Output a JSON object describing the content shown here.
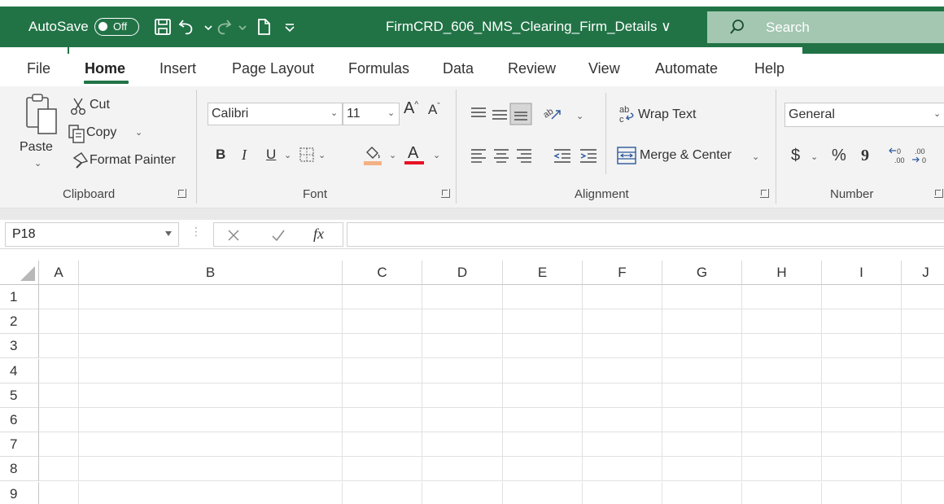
{
  "titlebar": {
    "autosave_label": "AutoSave",
    "autosave_state": "Off",
    "filename": "FirmCRD_606_NMS_Clearing_Firm_Details",
    "filename_chevron": "∨",
    "search_label": "Search",
    "icons": [
      "save-icon",
      "undo-icon",
      "redo-icon",
      "new-file-icon",
      "customize-qat-icon",
      "search-icon"
    ]
  },
  "tabs": [
    "File",
    "Home",
    "Insert",
    "Page Layout",
    "Formulas",
    "Data",
    "Review",
    "View",
    "Automate",
    "Help"
  ],
  "active_tab": "Home",
  "ribbon": {
    "clipboard": {
      "paste_label": "Paste",
      "cut_label": "Cut",
      "copy_label": "Copy",
      "format_painter_label": "Format Painter",
      "group_label": "Clipboard"
    },
    "font": {
      "font_name": "Calibri",
      "font_size": "11",
      "bold": "B",
      "italic": "I",
      "underline": "U",
      "group_label": "Font",
      "fill_color": "#f4b183",
      "font_color": "#e81123"
    },
    "alignment": {
      "wrap_text_label": "Wrap Text",
      "merge_center_label": "Merge & Center",
      "group_label": "Alignment"
    },
    "number": {
      "format": "General",
      "currency_symbol": "$",
      "percent_symbol": "%",
      "comma_symbol": "9",
      "group_label": "Number"
    }
  },
  "formula_bar": {
    "name_box": "P18",
    "fx_label": "fx",
    "formula": ""
  },
  "sheet": {
    "columns": [
      "A",
      "B",
      "C",
      "D",
      "E",
      "F",
      "G",
      "H",
      "I",
      "J"
    ],
    "rows": [
      "1",
      "2",
      "3",
      "4",
      "5",
      "6",
      "7",
      "8",
      "9"
    ]
  },
  "colors": {
    "accent": "#217346",
    "search_box": "#a3c7b1",
    "ribbon_bg": "#f3f3f3"
  }
}
